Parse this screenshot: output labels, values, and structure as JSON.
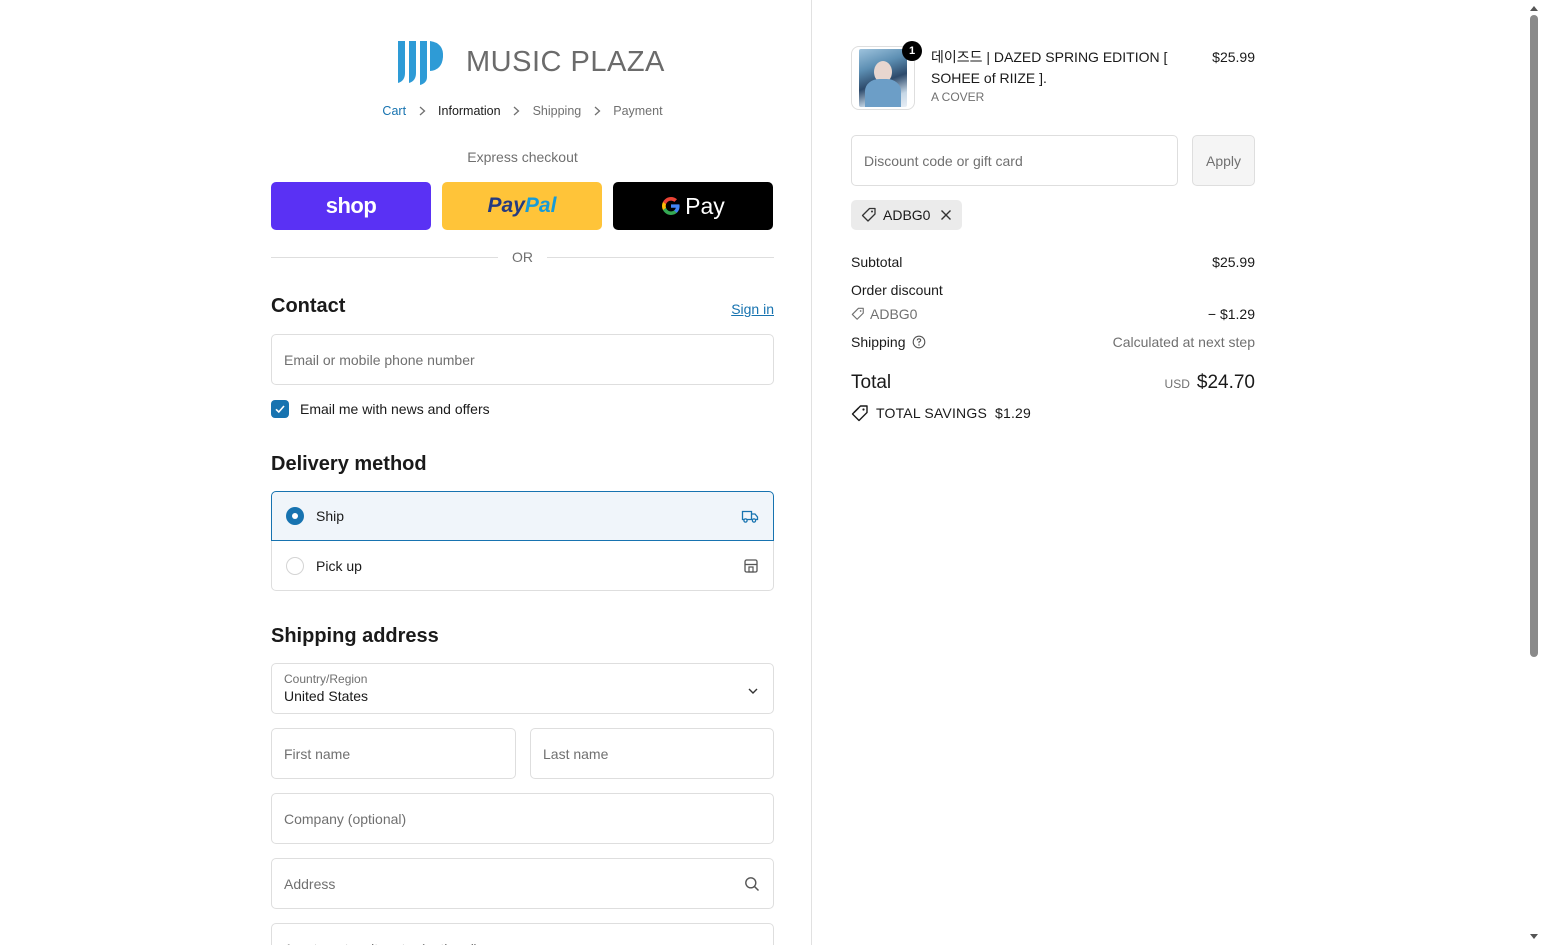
{
  "brand": {
    "name": "MUSIC PLAZA",
    "logo_icon": "music-plaza-logo"
  },
  "breadcrumb": [
    {
      "label": "Cart",
      "state": "link"
    },
    {
      "label": "Information",
      "state": "current"
    },
    {
      "label": "Shipping",
      "state": "upcoming"
    },
    {
      "label": "Payment",
      "state": "upcoming"
    }
  ],
  "express": {
    "label": "Express checkout",
    "shop_label": "shop",
    "paypal_part1": "Pay",
    "paypal_part2": "Pal",
    "gpay_label": "Pay",
    "or_label": "OR"
  },
  "contact": {
    "title": "Contact",
    "signin_label": "Sign in",
    "email_placeholder": "Email or mobile phone number",
    "newsletter_label": "Email me with news and offers",
    "newsletter_checked": true
  },
  "delivery": {
    "title": "Delivery method",
    "options": [
      {
        "label": "Ship",
        "selected": true,
        "icon": "truck-icon"
      },
      {
        "label": "Pick up",
        "selected": false,
        "icon": "store-icon"
      }
    ]
  },
  "shipping_address": {
    "title": "Shipping address",
    "country_label": "Country/Region",
    "country_value": "United States",
    "first_name_placeholder": "First name",
    "last_name_placeholder": "Last name",
    "company_placeholder": "Company (optional)",
    "address_placeholder": "Address",
    "apartment_placeholder": "Apartment, suite, etc. (optional)"
  },
  "summary": {
    "product": {
      "name": "데이즈드 | DAZED SPRING EDITION [ SOHEE of RIIZE ].",
      "variant": "A COVER",
      "price": "$25.99",
      "quantity": "1"
    },
    "discount_placeholder": "Discount code or gift card",
    "apply_label": "Apply",
    "applied_code": "ADBG0",
    "subtotal_label": "Subtotal",
    "subtotal_value": "$25.99",
    "order_discount_label": "Order discount",
    "discount_code": "ADBG0",
    "discount_value": "− $1.29",
    "shipping_label": "Shipping",
    "shipping_value": "Calculated at next step",
    "total_label": "Total",
    "total_currency": "USD",
    "total_value": "$24.70",
    "savings_label": "TOTAL SAVINGS",
    "savings_value": "$1.29"
  },
  "colors": {
    "accent": "#1773b0",
    "shop_pay": "#5a31f4",
    "paypal": "#ffc439",
    "gpay": "#000000"
  }
}
